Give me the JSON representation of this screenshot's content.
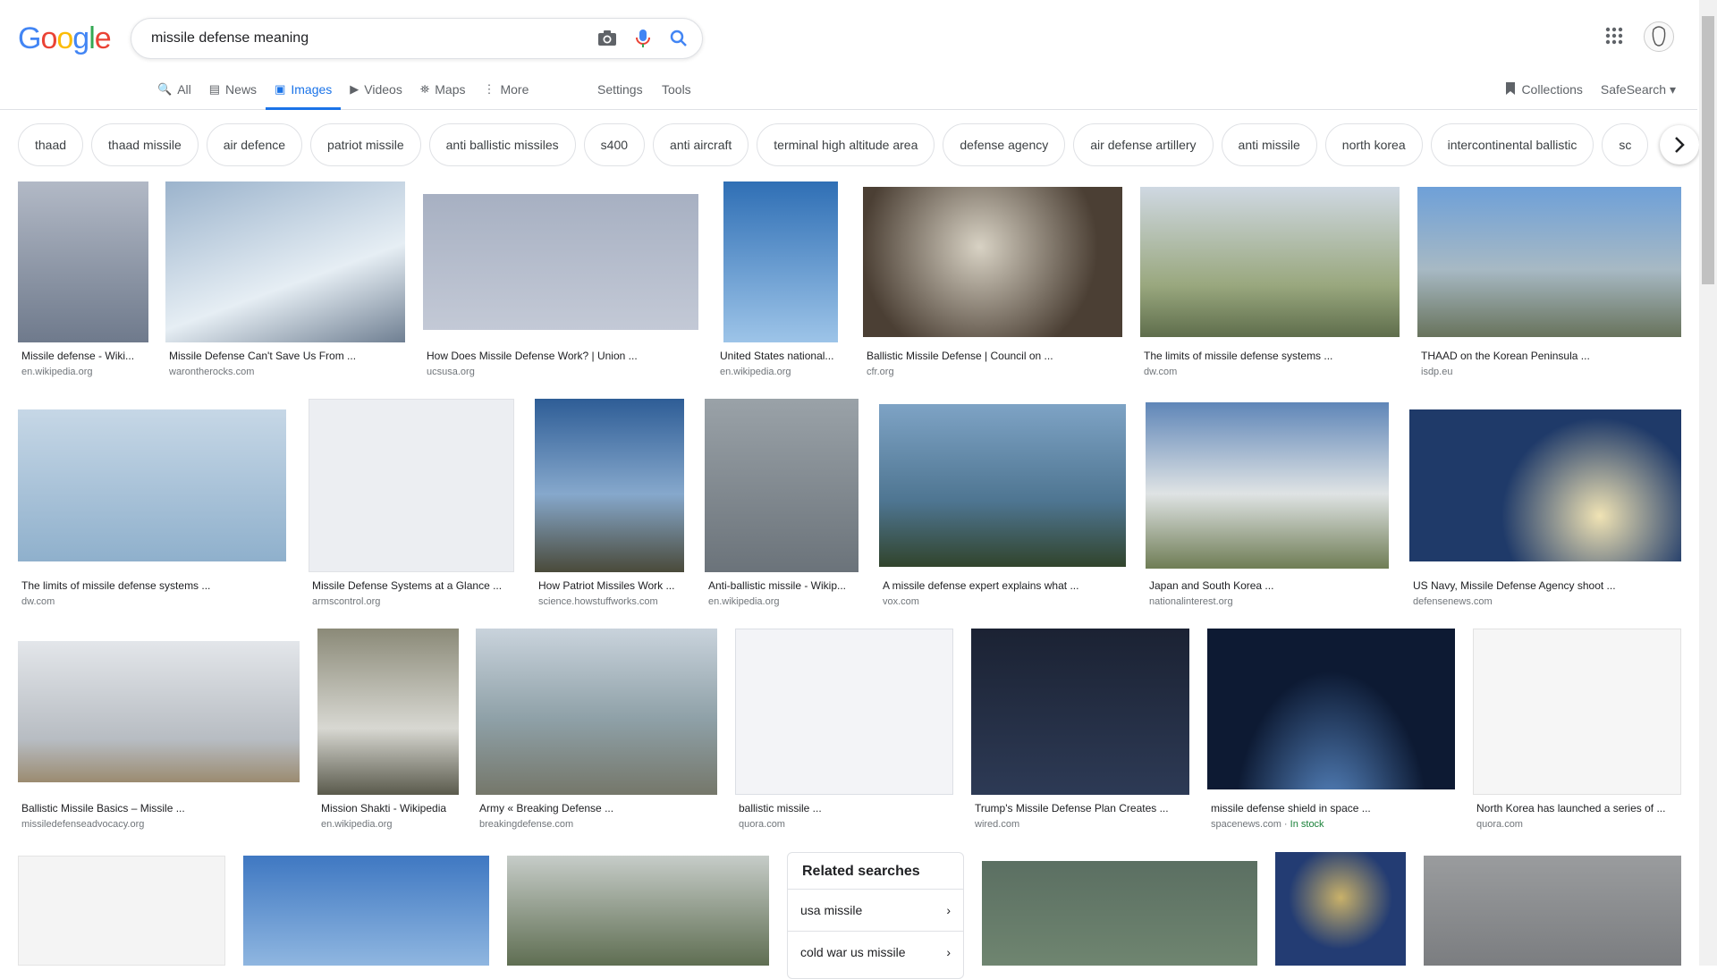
{
  "logo": {
    "letters": [
      "G",
      "o",
      "o",
      "g",
      "l",
      "e"
    ],
    "colors": [
      "#4285F4",
      "#EA4335",
      "#FBBC05",
      "#4285F4",
      "#34A853",
      "#EA4335"
    ]
  },
  "search": {
    "query": "missile defense meaning"
  },
  "icons": {
    "camera": "camera-icon",
    "mic": "microphone-icon",
    "search": "search-icon",
    "apps": "apps-grid-icon",
    "avatar": "avatar"
  },
  "tabs": [
    {
      "label": "All",
      "icon": "🔍"
    },
    {
      "label": "News",
      "icon": "▤"
    },
    {
      "label": "Images",
      "icon": "▣"
    },
    {
      "label": "Videos",
      "icon": "▶"
    },
    {
      "label": "Maps",
      "icon": "⛯"
    },
    {
      "label": "More",
      "icon": "⋮"
    }
  ],
  "tools": {
    "settings": "Settings",
    "tools": "Tools"
  },
  "right_tools": {
    "collections": "Collections",
    "safesearch": "SafeSearch ▾"
  },
  "chips": [
    "thaad",
    "thaad missile",
    "air defence",
    "patriot missile",
    "anti ballistic missiles",
    "s400",
    "anti aircraft",
    "terminal high altitude area",
    "defense agency",
    "air defense artillery",
    "anti missile",
    "north korea",
    "intercontinental ballistic",
    "sc"
  ],
  "results": {
    "row1": [
      {
        "caption": "Missile defense - Wiki...",
        "source": "en.wikipedia.org",
        "color": "#8a95a8"
      },
      {
        "caption": "Missile Defense Can't Save Us From ...",
        "source": "warontherocks.com",
        "color": "#7a8fa7"
      },
      {
        "caption": "How Does Missile Defense Work? | Union ...",
        "source": "ucsusa.org",
        "color": "#9ea8b8"
      },
      {
        "caption": "United States national...",
        "source": "en.wikipedia.org",
        "color": "#4f7bb0"
      },
      {
        "caption": "Ballistic Missile Defense | Council on ...",
        "source": "cfr.org",
        "color": "#4b3f34"
      },
      {
        "caption": "The limits of missile defense systems ...",
        "source": "dw.com",
        "color": "#6f7e63"
      },
      {
        "caption": "THAAD on the Korean Peninsula ...",
        "source": "isdp.eu",
        "color": "#6d7f86"
      }
    ],
    "row2": [
      {
        "caption": "The limits of missile defense systems ...",
        "source": "dw.com",
        "color": "#a9c2d6"
      },
      {
        "caption": "Missile Defense Systems at a Glance ...",
        "source": "armscontrol.org",
        "color": "#e6e8ee"
      },
      {
        "caption": "How Patriot Missiles Work ...",
        "source": "science.howstuffworks.com",
        "color": "#5d79a1"
      },
      {
        "caption": "Anti-ballistic missile - Wikip...",
        "source": "en.wikipedia.org",
        "color": "#747c83"
      },
      {
        "caption": "A missile defense expert explains what ...",
        "source": "vox.com",
        "color": "#507186"
      },
      {
        "caption": "Japan and South Korea ...",
        "source": "nationalinterest.org",
        "color": "#7d8c6c"
      },
      {
        "caption": "US Navy, Missile Defense Agency shoot ...",
        "source": "defensenews.com",
        "color": "#1f3a69"
      }
    ],
    "row3": [
      {
        "caption": "Ballistic Missile Basics – Missile ...",
        "source": "missiledefenseadvocacy.org",
        "color": "#aeb5bd"
      },
      {
        "caption": "Mission Shakti - Wikipedia",
        "source": "en.wikipedia.org",
        "color": "#6b6a5f"
      },
      {
        "caption": "Army « Breaking Defense ...",
        "source": "breakingdefense.com",
        "color": "#8ea0a7"
      },
      {
        "caption": "ballistic missile ...",
        "source": "quora.com",
        "color": "#eef0f4"
      },
      {
        "caption": "Trump's Missile Defense Plan Creates ...",
        "source": "wired.com",
        "color": "#1e2535"
      },
      {
        "caption": "missile defense shield in space ...",
        "source": "spacenews.com",
        "stock": "In stock",
        "color": "#1b2c4a"
      },
      {
        "caption": "North Korea has launched a series of ...",
        "source": "quora.com",
        "color": "#f2f2f2"
      }
    ],
    "row4": [
      {
        "color": "#f4f4f4"
      },
      {
        "color": "#6a9ad0"
      },
      {
        "color": "#6c7a66"
      },
      {
        "color": "#5f6e52"
      },
      {
        "color": "#233c73"
      },
      {
        "color": "#8b8d90"
      }
    ]
  },
  "related": {
    "title": "Related searches",
    "items": [
      "usa missile",
      "cold war us missile"
    ]
  }
}
